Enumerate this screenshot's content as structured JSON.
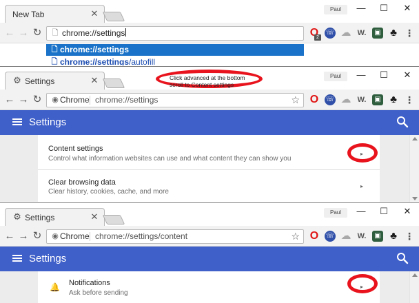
{
  "colors": {
    "appbar": "#3f5fc9",
    "annotation_red": "#e8131c",
    "selected_suggestion": "#1a73c8",
    "link_blue": "#1a4bb0"
  },
  "profile_name": "Paul",
  "window_controls": {
    "minimize": "—",
    "maximize": "☐",
    "close": "✕"
  },
  "nav": {
    "back": "←",
    "forward": "→",
    "reload": "↻"
  },
  "extensions": {
    "opera_badge": "2",
    "w_label": "W."
  },
  "step1": {
    "tab_title": "New Tab",
    "omnibox_text": "chrome://settings",
    "suggestions": [
      {
        "prefix": "chrome://settings",
        "suffix": ""
      },
      {
        "prefix": "chrome://settings",
        "suffix": "/autofill"
      }
    ]
  },
  "step2": {
    "tab_title": "Settings",
    "omnibox_chip": "Chrome",
    "omnibox_url": "chrome://settings",
    "annotation_line1": "Click advanced at the bottom",
    "annotation_line2": "scroll to Content settings",
    "appbar_title": "Settings",
    "rows": [
      {
        "title": "Content settings",
        "subtitle": "Control what information websites can use and what content they can show you"
      },
      {
        "title": "Clear browsing data",
        "subtitle": "Clear history, cookies, cache, and more"
      }
    ]
  },
  "step3": {
    "tab_title": "Settings",
    "omnibox_chip": "Chrome",
    "omnibox_url": "chrome://settings/content",
    "appbar_title": "Settings",
    "rows": [
      {
        "title": "Notifications",
        "subtitle": "Ask before sending"
      }
    ]
  }
}
